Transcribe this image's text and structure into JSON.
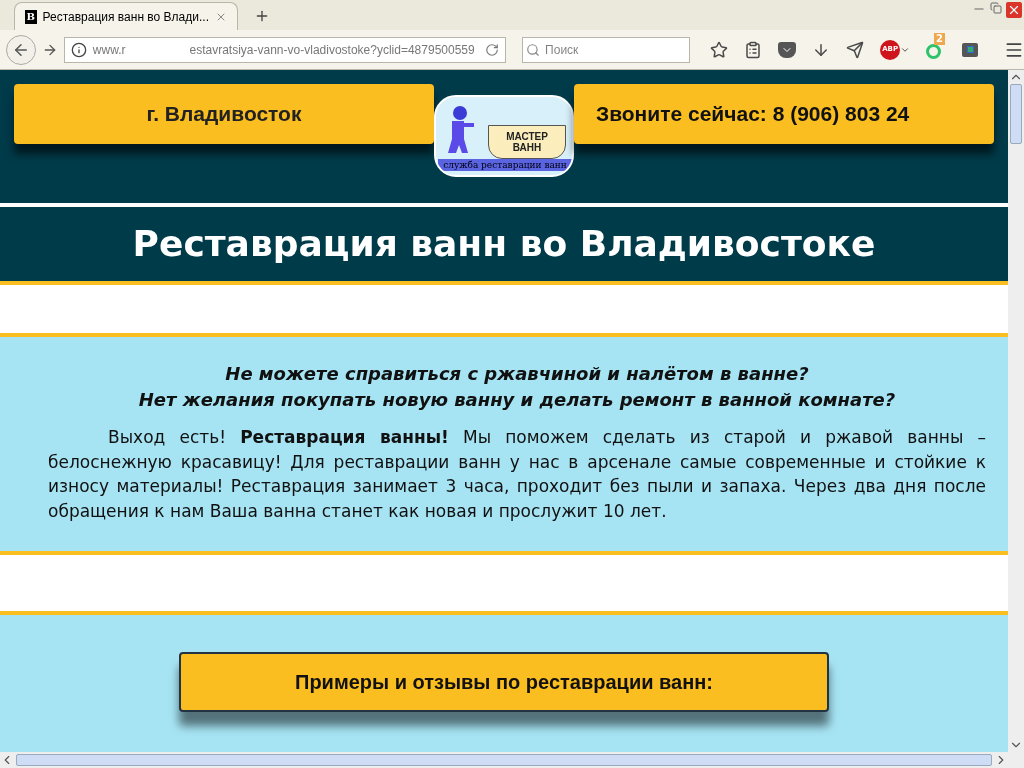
{
  "browser": {
    "tab": {
      "title": "Реставрация ванн во Влади...",
      "favicon": "B",
      "selected": true
    },
    "address": {
      "start": "www.r",
      "end": "estavratsiya-vann-vo-vladivostoke?yclid=4879500559"
    },
    "search": {
      "placeholder": "Поиск"
    },
    "adblock_label": "ABP",
    "extension_badge": "2"
  },
  "header": {
    "city": "г. Владивосток",
    "phone": "Звоните сейчас: 8 (906) 803 24",
    "logo": {
      "title": [
        "МАСТЕР",
        "ВАНН"
      ],
      "subtitle": "служба реставрации ванн"
    }
  },
  "heading": "Реставрация ванн во Владивостоке",
  "intro": {
    "questions": [
      "Не можете справиться с ржавчиной и налётом в ванне?",
      "Нет желания покупать новую ванну и делать ремонт в ванной комнате?"
    ],
    "paragraph": "Выход есть! **Реставрация ванны!** Мы поможем сделать из старой и ржавой ванны – белоснежную красавицу! Для реставрации ванн у нас в арсенале самые современные и стойкие к износу материалы! Реставрация занимает 3 часа, проходит без пыли и запаха. Через два дня после обращения к нам Ваша ванна станет как новая и прослужит 10 лет."
  },
  "examples_button": "Примеры и отзывы по реставрации ванн:"
}
